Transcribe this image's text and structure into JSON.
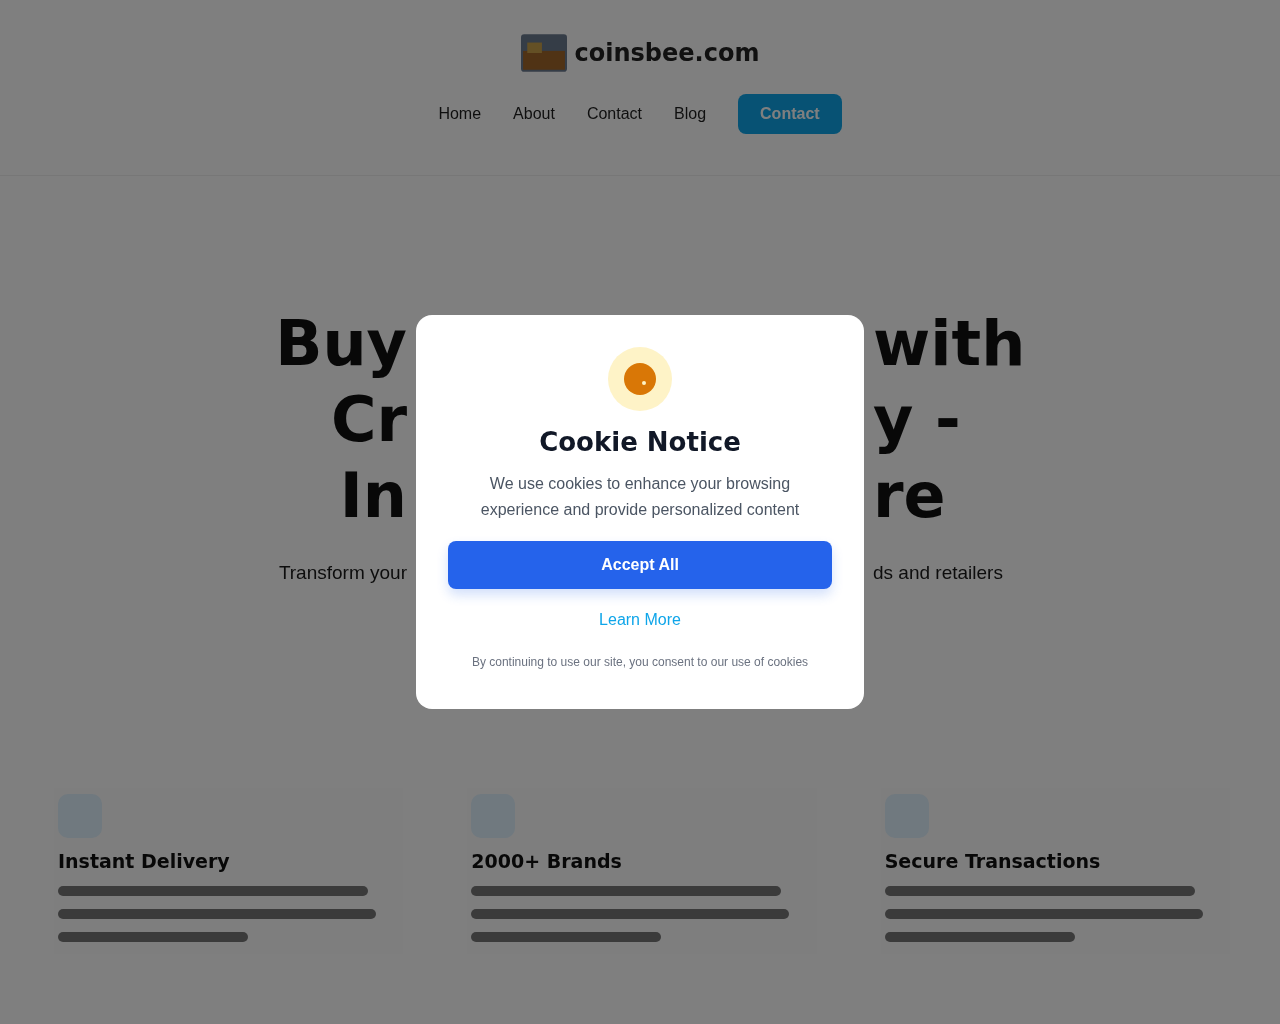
{
  "header": {
    "site_name": "coinsbee.com",
    "nav": [
      "Home",
      "About",
      "Contact",
      "Blog"
    ],
    "cta": "Contact"
  },
  "hero": {
    "title_lines": [
      {
        "left": "Buy",
        "right": "with"
      },
      {
        "left": "Cr",
        "right": "y -"
      },
      {
        "left": "In",
        "right": "re"
      }
    ],
    "subtitle": {
      "left": "Transform your",
      "right": "ds and retailers"
    }
  },
  "features": [
    {
      "title": "Instant Delivery"
    },
    {
      "title": "2000+ Brands"
    },
    {
      "title": "Secure Transactions"
    }
  ],
  "cookie_dialog": {
    "title": "Cookie Notice",
    "message": "We use cookies to enhance your browsing experience and provide personalized content",
    "accept": "Accept All",
    "learn_more": "Learn More",
    "footnote": "By continuing to use our site, you consent to our use of cookies"
  }
}
